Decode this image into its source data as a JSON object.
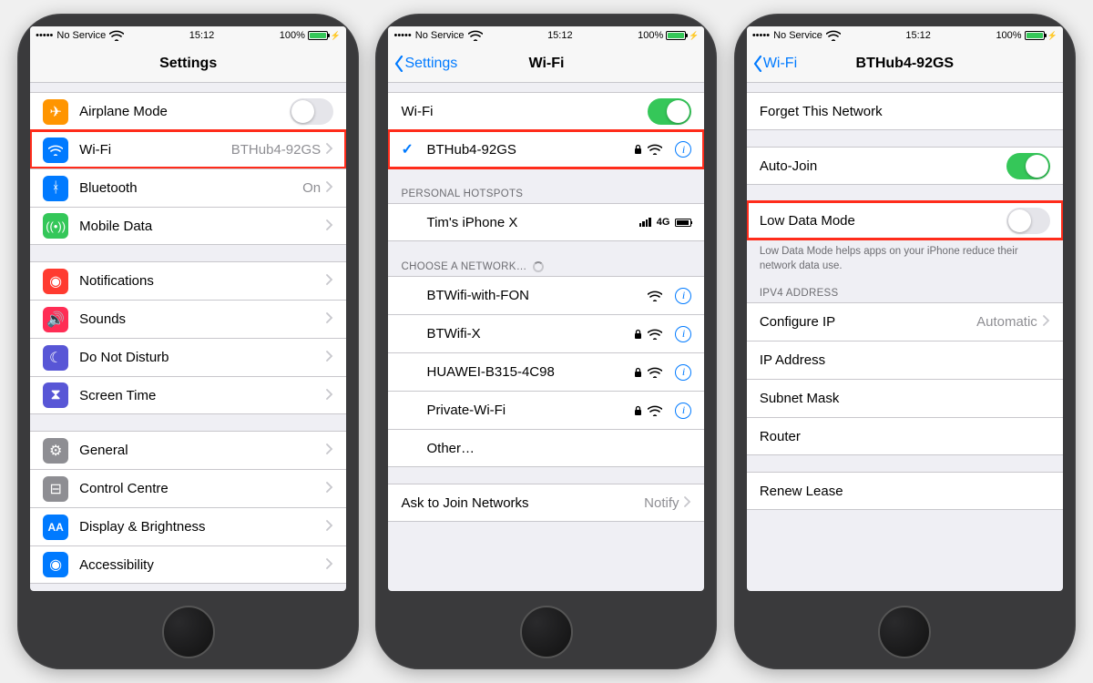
{
  "status": {
    "carrier": "No Service",
    "time": "15:12",
    "battery": "100%"
  },
  "screen1": {
    "title": "Settings",
    "items": {
      "airplane": "Airplane Mode",
      "wifi": "Wi-Fi",
      "wifi_value": "BTHub4-92GS",
      "bluetooth": "Bluetooth",
      "bluetooth_value": "On",
      "mobile": "Mobile Data",
      "notifications": "Notifications",
      "sounds": "Sounds",
      "dnd": "Do Not Disturb",
      "screentime": "Screen Time",
      "general": "General",
      "control": "Control Centre",
      "display": "Display & Brightness",
      "accessibility": "Accessibility"
    }
  },
  "screen2": {
    "back": "Settings",
    "title": "Wi-Fi",
    "wifi_label": "Wi-Fi",
    "connected": "BTHub4-92GS",
    "hotspots_header": "PERSONAL HOTSPOTS",
    "hotspot": "Tim's iPhone X",
    "hotspot_sig": "4G",
    "choose_header": "CHOOSE A NETWORK…",
    "net1": "BTWifi-with-FON",
    "net2": "BTWifi-X",
    "net3": "HUAWEI-B315-4C98",
    "net4": "Private-Wi-Fi",
    "other": "Other…",
    "ask": "Ask to Join Networks",
    "ask_value": "Notify"
  },
  "screen3": {
    "back": "Wi-Fi",
    "title": "BTHub4-92GS",
    "forget": "Forget This Network",
    "autojoin": "Auto-Join",
    "lowdata": "Low Data Mode",
    "lowdata_footer": "Low Data Mode helps apps on your iPhone reduce their network data use.",
    "ipv4_header": "IPV4 ADDRESS",
    "configure": "Configure IP",
    "configure_value": "Automatic",
    "ip": "IP Address",
    "subnet": "Subnet Mask",
    "router": "Router",
    "renew": "Renew Lease"
  }
}
